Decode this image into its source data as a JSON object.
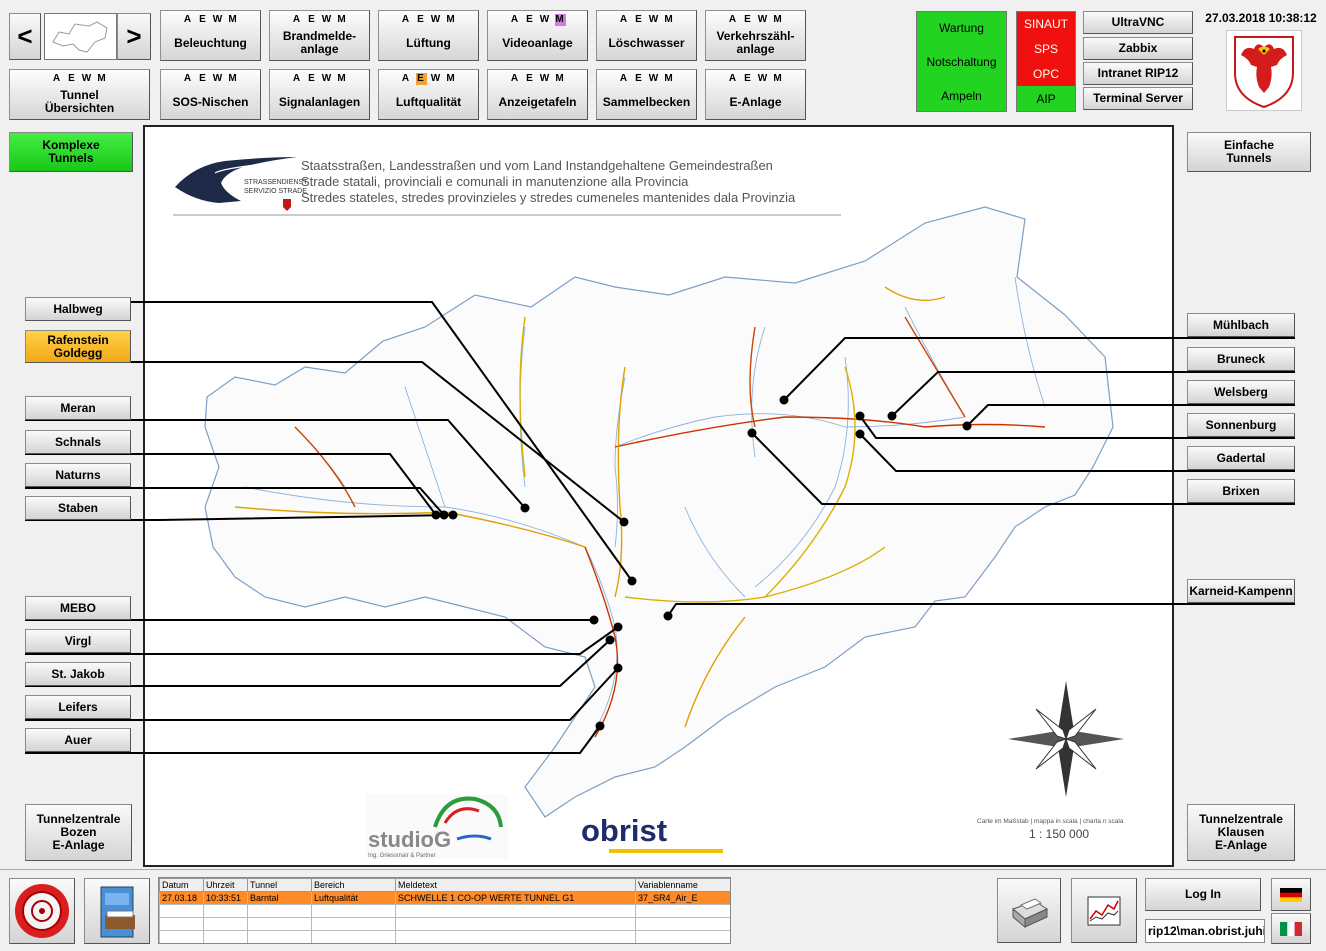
{
  "nav": {
    "prev_glyph": "<",
    "next_glyph": ">"
  },
  "aewm_letters": [
    "A",
    "E",
    "W",
    "M"
  ],
  "systems_row1": [
    {
      "label": "Beleuchtung",
      "hl": null
    },
    {
      "label": "Brandmelde-\nanlage",
      "hl": null
    },
    {
      "label": "Lüftung",
      "hl": null
    },
    {
      "label": "Videoanlage",
      "hl": {
        "index": 3,
        "color": "violet"
      }
    },
    {
      "label": "Löschwasser",
      "hl": null
    },
    {
      "label": "Verkehrszähl-\nanlage",
      "hl": null
    }
  ],
  "systems_row2": [
    {
      "label": "Tunnel\nÜbersichten",
      "hl": null
    },
    {
      "label": "SOS-Nischen",
      "hl": null
    },
    {
      "label": "Signalanlagen",
      "hl": null
    },
    {
      "label": "Luftqualität",
      "hl": {
        "index": 1,
        "color": "orange"
      }
    },
    {
      "label": "Anzeigetafeln",
      "hl": null
    },
    {
      "label": "Sammelbecken",
      "hl": null
    },
    {
      "label": "E-Anlage",
      "hl": null
    }
  ],
  "status_panel": {
    "wartung": "Wartung",
    "notschaltung": "Notschaltung",
    "ampeln": "Ampeln",
    "sinaut": "SINAUT",
    "sps": "SPS",
    "opc": "OPC",
    "aip": "AIP"
  },
  "tools": [
    "UltraVNC",
    "Zabbix",
    "Intranet RIP12",
    "Terminal Server"
  ],
  "datetime": "27.03.2018 10:38:12",
  "view_buttons": {
    "complex": "Komplexe\nTunnels",
    "simple": "Einfache\nTunnels"
  },
  "tunnels_left": [
    {
      "label": "Halbweg",
      "state": "normal"
    },
    {
      "label": "Rafenstein\nGoldegg",
      "state": "warning"
    },
    {
      "label": "Meran",
      "state": "normal"
    },
    {
      "label": "Schnals",
      "state": "normal"
    },
    {
      "label": "Naturns",
      "state": "normal"
    },
    {
      "label": "Staben",
      "state": "normal"
    },
    {
      "label": "MEBO",
      "state": "normal"
    },
    {
      "label": "Virgl",
      "state": "normal"
    },
    {
      "label": "St. Jakob",
      "state": "normal"
    },
    {
      "label": "Leifers",
      "state": "normal"
    },
    {
      "label": "Auer",
      "state": "normal"
    }
  ],
  "tunnels_right": [
    {
      "label": "Mühlbach",
      "state": "normal"
    },
    {
      "label": "Bruneck",
      "state": "normal"
    },
    {
      "label": "Welsberg",
      "state": "normal"
    },
    {
      "label": "Sonnenburg",
      "state": "normal"
    },
    {
      "label": "Gadertal",
      "state": "normal"
    },
    {
      "label": "Brixen",
      "state": "normal"
    },
    {
      "label": "Karneid-Kampenn",
      "state": "normal"
    }
  ],
  "control_centers": {
    "left": "Tunnelzentrale\nBozen\nE-Anlage",
    "right": "Tunnelzentrale\nKlausen\nE-Anlage"
  },
  "map": {
    "header_lines": [
      "Staatsstraßen, Landesstraßen und vom Land Instandgehaltene Gemeindestraßen",
      "Strade statali, provinciali e comunali in manutenzione alla Provincia",
      "Stredes stateles, stredes provinzieles y stredes cumeneles mantenides dala Provinzia"
    ],
    "agency_lines": [
      "STRASSENDIENST",
      "SERVIZIO STRADE"
    ],
    "scale_caption": "Carte im Maßstab | mappa in scala | charta n scala",
    "scale_value": "1 : 150 000",
    "logo_studio": "studioG",
    "logo_studio_sub": "Ing. Griessmair & Partner",
    "logo_obrist": "obrist"
  },
  "alarm_table": {
    "columns": [
      "Datum",
      "Uhrzeit",
      "Tunnel",
      "Bereich",
      "Meldetext",
      "Variablenname"
    ],
    "rows": [
      [
        "27.03.18",
        "10:33:51",
        "Barntal",
        "Luftqualität",
        "SCHWELLE 1 CO-OP WERTE TUNNEL G1",
        "37_SR4_Air_E"
      ],
      [
        "",
        "",
        "",
        "",
        "",
        ""
      ],
      [
        "",
        "",
        "",
        "",
        "",
        ""
      ],
      [
        "",
        "",
        "",
        "",
        "",
        ""
      ]
    ]
  },
  "login": {
    "label": "Log In",
    "user": "rip12\\man.obrist.juhi"
  },
  "colors": {
    "active_green": "#22d322",
    "alarm_red": "#f01010",
    "warning_amber": "#f5b020",
    "alarm_row": "#ff8a28"
  }
}
